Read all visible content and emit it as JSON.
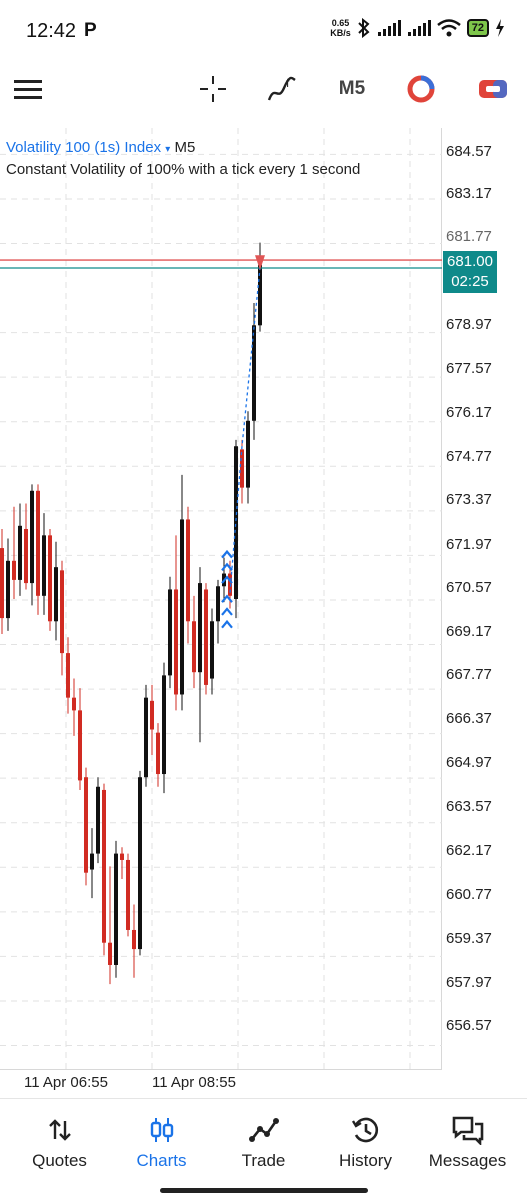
{
  "status_bar": {
    "time": "12:42",
    "carrier_icon": "P",
    "net_speed_value": "0.65",
    "net_speed_unit": "KB/s",
    "battery": "72"
  },
  "toolbar": {
    "timeframe": "M5"
  },
  "chart": {
    "symbol": "Volatility 100 (1s) Index",
    "symbol_caret": "▾",
    "timeframe": "M5",
    "description": "Constant Volatility of 100% with a tick every 1 second",
    "price_ticks": [
      "684.57",
      "683.17",
      "681.77",
      "678.97",
      "677.57",
      "676.17",
      "674.77",
      "673.37",
      "671.97",
      "670.57",
      "669.17",
      "667.77",
      "666.37",
      "664.97",
      "663.57",
      "662.17",
      "660.77",
      "659.37",
      "657.97",
      "656.57"
    ],
    "current_price": "681.00",
    "countdown": "02:25",
    "time_labels": [
      "11 Apr 06:55",
      "11 Apr 08:55"
    ],
    "colors": {
      "bull": "#111111",
      "bear": "#d12b22",
      "ask_line": "#e05555",
      "bid_line": "#0f8a8a",
      "accent": "#1a73e8"
    }
  },
  "chart_data": {
    "type": "candlestick",
    "y_range": [
      655.8,
      685.4
    ],
    "candles": [
      [
        672.2,
        672.8,
        669.5,
        670.0
      ],
      [
        670.0,
        672.5,
        669.6,
        671.8
      ],
      [
        671.8,
        673.5,
        670.6,
        671.2
      ],
      [
        671.2,
        673.6,
        670.7,
        672.9
      ],
      [
        672.8,
        673.6,
        670.9,
        671.1
      ],
      [
        671.1,
        674.2,
        670.4,
        674.0
      ],
      [
        674.0,
        674.2,
        670.1,
        670.7
      ],
      [
        670.7,
        673.3,
        670.1,
        672.6
      ],
      [
        672.6,
        672.8,
        669.6,
        669.9
      ],
      [
        669.9,
        672.4,
        669.3,
        671.6
      ],
      [
        671.5,
        671.8,
        668.2,
        668.9
      ],
      [
        668.9,
        669.4,
        667.0,
        667.5
      ],
      [
        667.5,
        668.1,
        666.3,
        667.1
      ],
      [
        667.1,
        667.8,
        664.6,
        664.9
      ],
      [
        665.0,
        665.3,
        661.6,
        662.0
      ],
      [
        662.1,
        663.4,
        661.2,
        662.6
      ],
      [
        662.6,
        665.0,
        662.3,
        664.7
      ],
      [
        664.6,
        664.8,
        659.4,
        659.8
      ],
      [
        659.8,
        662.2,
        658.5,
        659.1
      ],
      [
        659.1,
        663.0,
        658.7,
        662.6
      ],
      [
        662.6,
        662.8,
        661.8,
        662.4
      ],
      [
        662.4,
        662.6,
        660.0,
        660.2
      ],
      [
        660.2,
        661.0,
        658.7,
        659.6
      ],
      [
        659.6,
        665.2,
        659.4,
        665.0
      ],
      [
        665.0,
        667.9,
        664.7,
        667.5
      ],
      [
        667.4,
        667.9,
        665.7,
        666.5
      ],
      [
        666.4,
        666.7,
        664.7,
        665.1
      ],
      [
        665.1,
        668.6,
        664.5,
        668.2
      ],
      [
        668.2,
        671.3,
        667.8,
        670.9
      ],
      [
        670.9,
        672.6,
        667.1,
        667.6
      ],
      [
        667.6,
        674.5,
        667.1,
        673.1
      ],
      [
        673.1,
        673.5,
        669.2,
        669.9
      ],
      [
        669.9,
        670.7,
        667.8,
        668.3
      ],
      [
        668.3,
        671.6,
        666.1,
        671.1
      ],
      [
        670.9,
        671.1,
        667.6,
        667.9
      ],
      [
        668.1,
        670.3,
        667.6,
        669.9
      ],
      [
        669.9,
        671.2,
        669.2,
        671.0
      ],
      [
        671.0,
        671.9,
        670.5,
        671.4
      ],
      [
        671.4,
        671.8,
        670.3,
        670.7
      ],
      [
        670.6,
        675.6,
        670.0,
        675.4
      ],
      [
        675.3,
        675.6,
        673.6,
        674.1
      ],
      [
        674.1,
        676.5,
        673.6,
        676.2
      ],
      [
        676.2,
        679.9,
        675.6,
        679.2
      ],
      [
        679.2,
        681.8,
        679.0,
        681.1
      ]
    ],
    "x_time_labels": [
      "11 Apr 06:55",
      "11 Apr 08:55"
    ]
  },
  "bottom_nav": {
    "items": [
      {
        "label": "Quotes",
        "icon": "arrows-updown-icon"
      },
      {
        "label": "Charts",
        "icon": "candles-icon",
        "active": true
      },
      {
        "label": "Trade",
        "icon": "trade-line-icon"
      },
      {
        "label": "History",
        "icon": "history-clock-icon"
      },
      {
        "label": "Messages",
        "icon": "messages-icon"
      }
    ]
  }
}
